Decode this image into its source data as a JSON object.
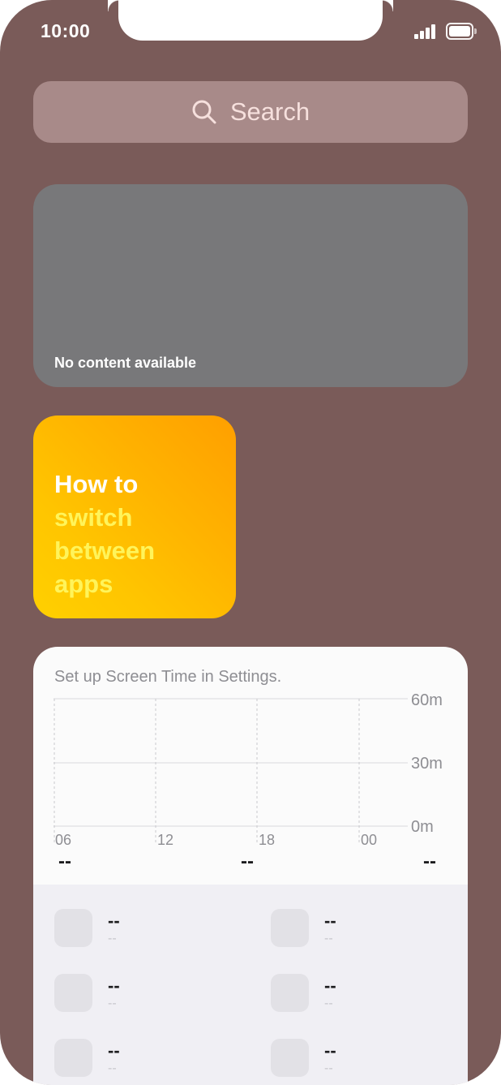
{
  "status_bar": {
    "time": "10:00"
  },
  "search": {
    "label": "Search"
  },
  "empty_widget": {
    "message": "No content available"
  },
  "tips_widget": {
    "title": "How to",
    "subtitle_lines": [
      "switch",
      "between",
      "apps"
    ]
  },
  "screen_time": {
    "heading": "Set up Screen Time in Settings.",
    "y_labels": [
      "60m",
      "30m",
      "0m"
    ],
    "x_labels": [
      "06",
      "12",
      "18",
      "00"
    ],
    "summary": [
      "--",
      "--",
      "--"
    ],
    "apps": [
      {
        "name": "--",
        "time": "--"
      },
      {
        "name": "--",
        "time": "--"
      },
      {
        "name": "--",
        "time": "--"
      },
      {
        "name": "--",
        "time": "--"
      },
      {
        "name": "--",
        "time": "--"
      },
      {
        "name": "--",
        "time": "--"
      }
    ]
  },
  "colors": {
    "wallpaper": "#7a5b59",
    "search_bg": "#a88a89",
    "empty_widget_bg": "#78787a",
    "tips_gradient_start": "#ffd000",
    "tips_gradient_end": "#ff9f00",
    "tips_subtitle": "#fff45a"
  }
}
